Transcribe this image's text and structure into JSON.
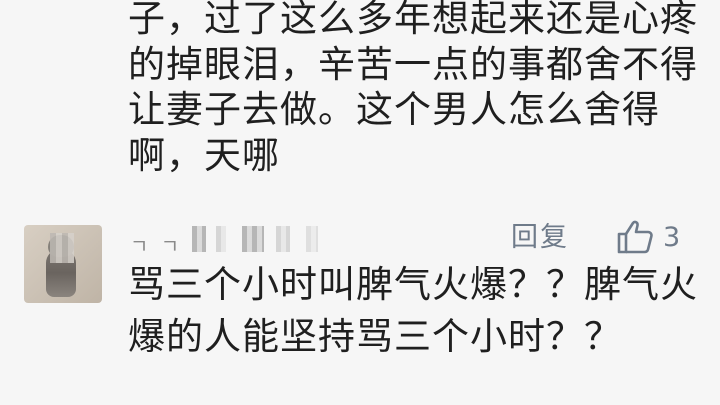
{
  "previous_comment": {
    "lines": [
      "子，过了这么多年想起来还是心疼",
      "的掉眼泪，辛苦一点的事都舍不得",
      "让妻子去做。这个男人怎么舍得",
      "啊，天哪"
    ]
  },
  "comment": {
    "username_visible": "ㄱ ㄱ",
    "reply_label": "回复",
    "like_icon": "thumbs-up-icon",
    "like_count": "3",
    "body_lines": [
      "骂三个小时叫脾气火爆？？脾气火",
      "爆的人能坚持骂三个小时？？"
    ]
  },
  "colors": {
    "background": "#f6f6f6",
    "text": "#1f1f1f",
    "meta": "#6f7b8a"
  }
}
